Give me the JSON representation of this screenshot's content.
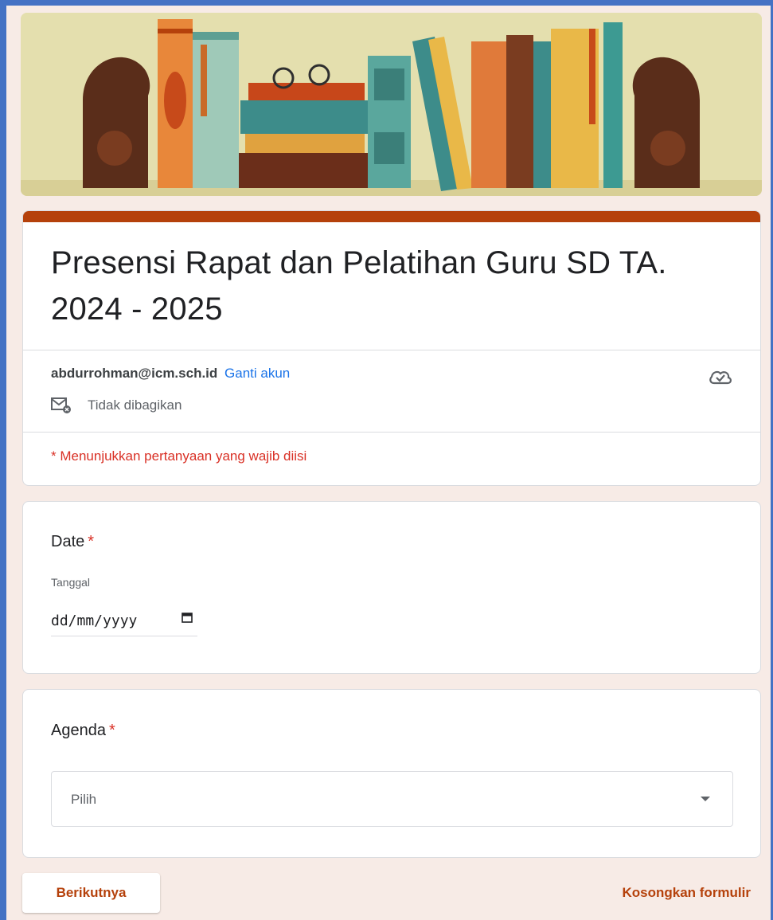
{
  "colors": {
    "accent": "#b5410b",
    "link": "#1a73e8",
    "required": "#d93025",
    "page_bg": "#f7ebe6"
  },
  "header": {
    "banner_image": "books-illustration"
  },
  "form": {
    "title": "Presensi Rapat dan Pelatihan Guru SD TA. 2024 - 2025",
    "account_email": "abdurrohman@icm.sch.id",
    "switch_account": "Ganti akun",
    "not_shared": "Tidak dibagikan",
    "required_note": "* Menunjukkan pertanyaan yang wajib diisi",
    "icons": {
      "cloud": "cloud-check-icon",
      "mail": "mail-not-shared-icon",
      "calendar": "calendar-icon",
      "dropdown": "dropdown-arrow-icon"
    }
  },
  "questions": {
    "date": {
      "label": "Date",
      "required_mark": "*",
      "sublabel": "Tanggal",
      "placeholder": "dd/mm/yyyy"
    },
    "agenda": {
      "label": "Agenda",
      "required_mark": "*",
      "selected": "Pilih"
    }
  },
  "footer": {
    "next_label": "Berikutnya",
    "clear_label": "Kosongkan formulir"
  }
}
